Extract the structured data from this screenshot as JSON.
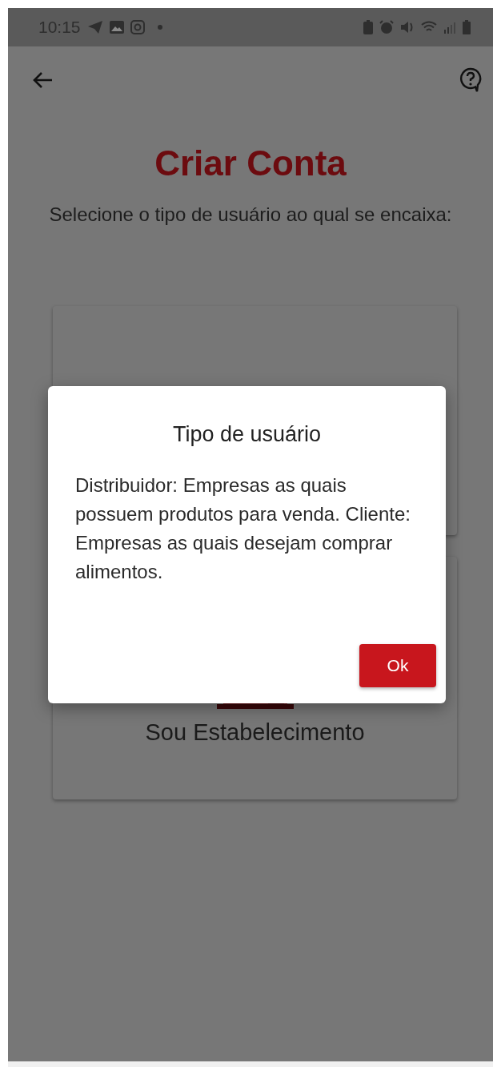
{
  "status_bar": {
    "time": "10:15"
  },
  "screen": {
    "title": "Criar Conta",
    "subtitle": "Selecione o tipo de usuário ao qual se encaixa:"
  },
  "cards": [
    {
      "kind": "hidden"
    },
    {
      "kind": "establishment",
      "label": "Sou Estabelecimento"
    }
  ],
  "dialog": {
    "title": "Tipo de usuário",
    "lines": [
      "Distribuidor: Empresas as quais possuem produtos para venda.",
      "Cliente: Empresas as quais desejam comprar alimentos."
    ],
    "button": "Ok"
  }
}
